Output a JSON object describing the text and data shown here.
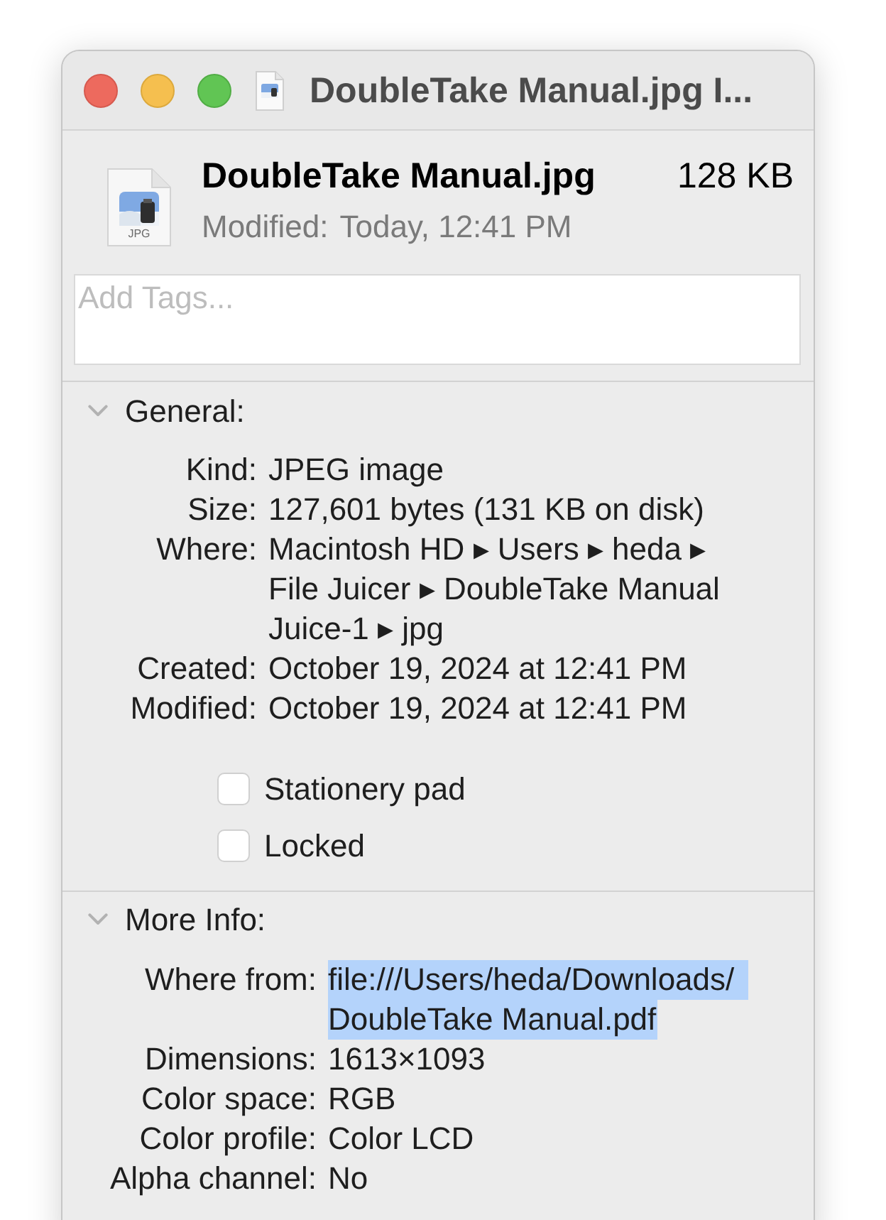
{
  "window": {
    "title": "DoubleTake Manual.jpg I..."
  },
  "header": {
    "name": "DoubleTake Manual.jpg",
    "size": "128 KB",
    "modified_label": "Modified:",
    "modified_value": "Today, 12:41 PM",
    "icon_label": "JPG"
  },
  "tags_field": {
    "placeholder": "Add Tags..."
  },
  "sections": [
    {
      "title": "General:",
      "expanded": true,
      "rows": [
        {
          "label": "Kind:",
          "lines": [
            "JPEG image"
          ],
          "selected": false
        },
        {
          "label": "Size:",
          "lines": [
            "127,601 bytes (131 KB on disk)"
          ],
          "selected": false
        },
        {
          "label": "Where:",
          "lines": [
            "Macintosh HD ▸ Users ▸ heda ▸",
            "File Juicer ▸ DoubleTake Manual",
            "Juice-1 ▸ jpg"
          ],
          "selected": false
        },
        {
          "label": "Created:",
          "lines": [
            "October 19, 2024 at 12:41 PM"
          ],
          "selected": false
        },
        {
          "label": "Modified:",
          "lines": [
            "October 19, 2024 at 12:41 PM"
          ],
          "selected": false
        }
      ],
      "checkboxes": [
        {
          "label": "Stationery pad",
          "checked": false
        },
        {
          "label": "Locked",
          "checked": false
        }
      ]
    },
    {
      "title": "More Info:",
      "expanded": true,
      "rows": [
        {
          "label": "Where from:",
          "lines": [
            "file:///Users/heda/Downloads/",
            "DoubleTake Manual.pdf"
          ],
          "selected": true
        },
        {
          "label": "Dimensions:",
          "lines": [
            "1613×1093"
          ],
          "selected": false
        },
        {
          "label": "Color space:",
          "lines": [
            "RGB"
          ],
          "selected": false
        },
        {
          "label": "Color profile:",
          "lines": [
            "Color LCD"
          ],
          "selected": false
        },
        {
          "label": "Alpha channel:",
          "lines": [
            "No"
          ],
          "selected": false
        }
      ]
    }
  ]
}
